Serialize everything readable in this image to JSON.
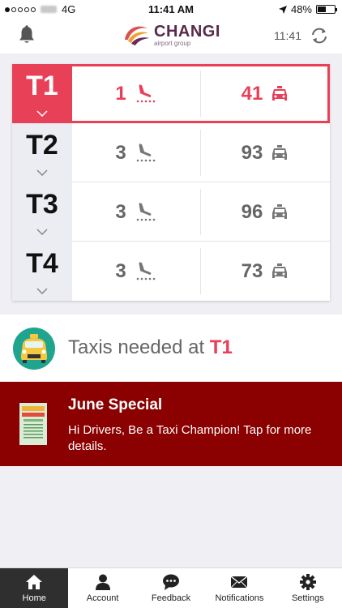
{
  "status_bar": {
    "network": "4G",
    "time": "11:41 AM",
    "battery": "48%",
    "battery_level": 0.48
  },
  "header": {
    "logo_title": "CHANGI",
    "logo_subtitle": "airport group",
    "last_updated": "11:41",
    "icons": {
      "left": "bell-icon",
      "right": "refresh-icon"
    }
  },
  "terminals": [
    {
      "name": "T1",
      "flights": "1",
      "taxis": "41",
      "selected": true
    },
    {
      "name": "T2",
      "flights": "3",
      "taxis": "93",
      "selected": false
    },
    {
      "name": "T3",
      "flights": "3",
      "taxis": "96",
      "selected": false
    },
    {
      "name": "T4",
      "flights": "3",
      "taxis": "73",
      "selected": false
    }
  ],
  "taxi_needed": {
    "prefix": "Taxis needed at",
    "terminal": "T1"
  },
  "promo": {
    "title": "June Special",
    "body": "Hi Drivers, Be a Taxi Champion! Tap for more details."
  },
  "tabs": [
    {
      "label": "Home",
      "icon": "home-icon",
      "active": true
    },
    {
      "label": "Account",
      "icon": "person-icon",
      "active": false
    },
    {
      "label": "Feedback",
      "icon": "chat-bubble-icon",
      "active": false
    },
    {
      "label": "Notifications",
      "icon": "envelope-icon",
      "active": false
    },
    {
      "label": "Settings",
      "icon": "gear-icon",
      "active": false
    }
  ],
  "colors": {
    "accent": "#e84057",
    "promo_background": "#8b0000",
    "active_tab": "#2f2f2f",
    "terminal_label_bg": "#ececf3"
  }
}
